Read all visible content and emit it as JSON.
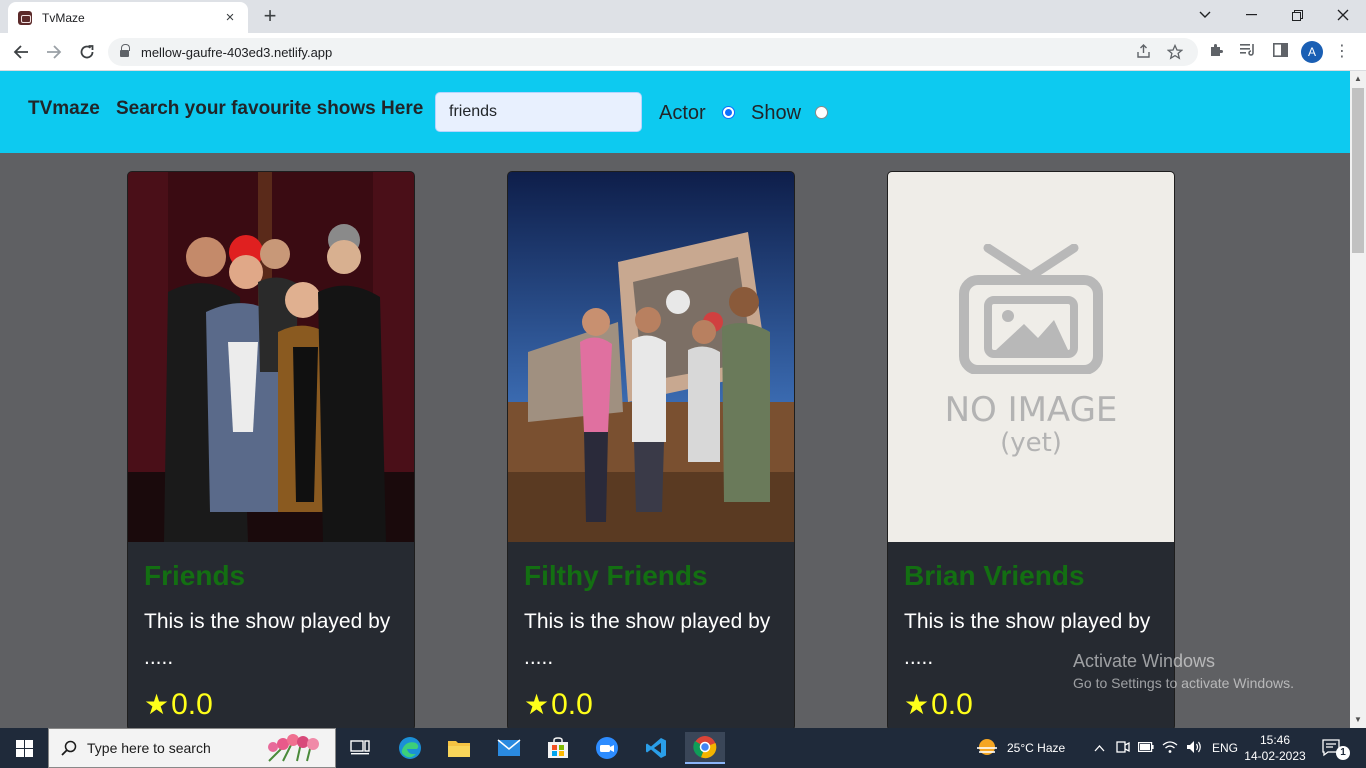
{
  "browser": {
    "tab_title": "TvMaze",
    "tab_close": "×",
    "new_tab": "+",
    "url": "mellow-gaufre-403ed3.netlify.app",
    "profile_initial": "A"
  },
  "header": {
    "brand": "TVmaze",
    "tagline": "Search your favourite shows Here",
    "search_value": "friends",
    "radio_actor_label": "Actor",
    "radio_show_label": "Show",
    "selected_option": "Actor"
  },
  "cards": [
    {
      "title": "Friends",
      "description": "This is the show played by .....",
      "rating": "0.0",
      "star": "★"
    },
    {
      "title": "Filthy Friends",
      "description": "This is the show played by .....",
      "rating": "0.0",
      "star": "★"
    },
    {
      "title": "Brian Vriends",
      "description": "This is the show played by .....",
      "rating": "0.0",
      "star": "★"
    }
  ],
  "no_image": {
    "line1": "NO IMAGE",
    "line2": "(yet)"
  },
  "watermark": {
    "line1": "Activate Windows",
    "line2": "Go to Settings to activate Windows."
  },
  "taskbar": {
    "search_placeholder": "Type here to search",
    "weather": "25°C  Haze",
    "language": "ENG",
    "time": "15:46",
    "date": "14-02-2023",
    "notifications": "1"
  },
  "colors": {
    "header_bg": "#0dcaf0",
    "page_bg": "#5f6063",
    "card_bg": "#262a31",
    "title_green": "#136f12",
    "rating_yellow": "#ffff1a"
  }
}
